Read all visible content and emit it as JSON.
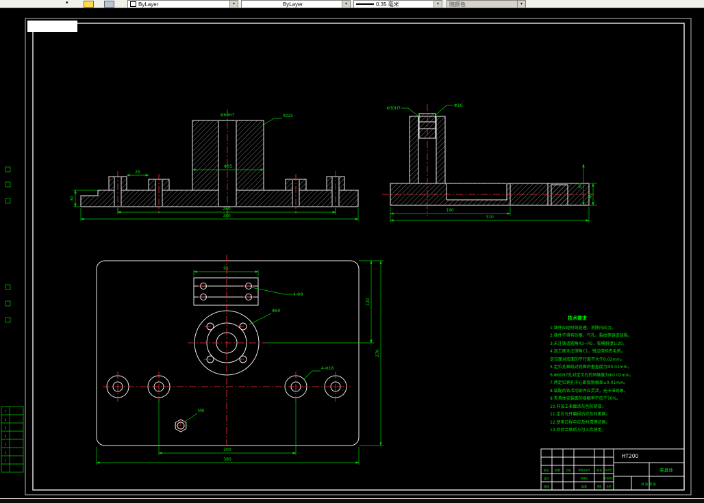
{
  "toolbar": {
    "color_value": "ByLayer",
    "linetype_value": "ByLayer",
    "lineweight_value": "0.35 毫米",
    "plotstyle_value": "随颜色"
  },
  "notes": {
    "title": "技术要求",
    "lines": [
      "1.铸件应经时效处理，消除内应力。",
      "2.铸件不得有砂眼、气孔、裂纹等铸造缺陷。",
      "3.未注铸造圆角R3~R5，拔模斜度1:20。",
      "4.加工面未注倒角C1，锐边倒钝去毛刺。",
      "  定位面对底面的平行度不大于0.02mm。",
      "5.定位孔轴线对底面的垂直度为Φ0.02mm。",
      "6.Φ60H7孔对定位孔的同轴度为Φ0.02mm。",
      "7.两定位销孔中心距极限偏差±0.01mm。",
      "8.装配后各活动部件应灵活，无卡滞现象。",
      "9.夹具体安装面的接触率不低于70%。",
      "10.非加工表面涂灰色防锈漆。",
      "11.定位元件磨损后应及时更换。",
      "12.使用过程中应及时清理切屑。",
      "13.检验合格后方可入库使用。"
    ]
  },
  "labels": {
    "front": [
      "260",
      "380",
      "30",
      "Φ85",
      "Φ60H7",
      "Rz25",
      "25"
    ],
    "side": [
      "190",
      "310",
      "60",
      "40",
      "Φ30H7",
      "Φ16"
    ],
    "plan": [
      "95",
      "200",
      "380",
      "120",
      "270",
      "4-Φ9",
      "4-Φ18",
      "Φ60",
      "M8"
    ]
  },
  "title_block": {
    "material": "HT200",
    "part_name": "夹具体",
    "row_headers": [
      "标记",
      "处数",
      "分区",
      "更改文件号",
      "签名",
      "年月日"
    ],
    "role_design": "设计",
    "role_standard": "标准化",
    "role_check": "审核",
    "role_approve": "批准",
    "stage_label": "阶段标记",
    "weight_label": "重量",
    "scale_label": "比例",
    "sheet": "共 张 第 张"
  },
  "bom": {
    "rows": [
      "7",
      "6",
      "5",
      "4",
      "3",
      "2",
      "1"
    ]
  }
}
